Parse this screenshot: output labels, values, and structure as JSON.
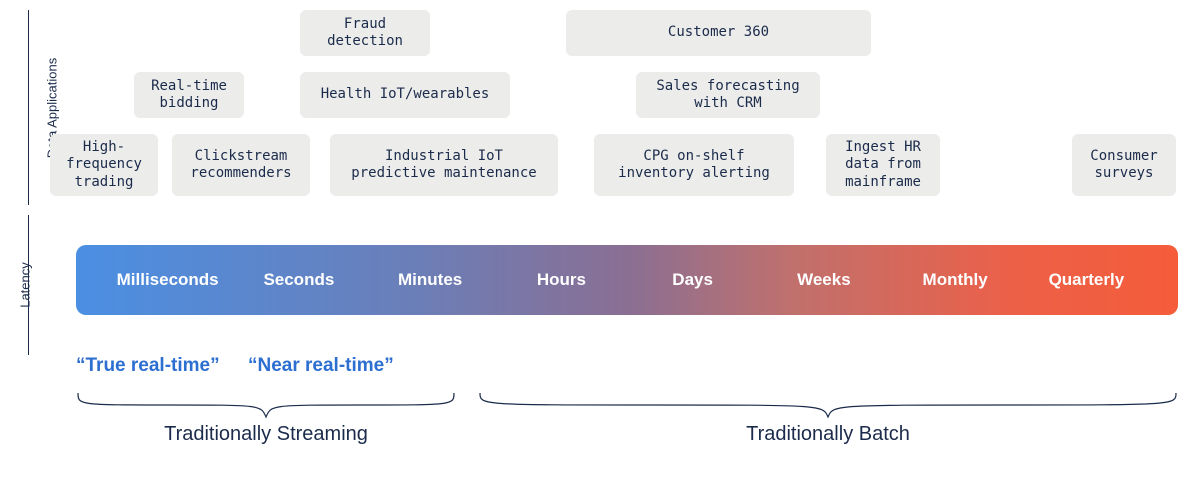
{
  "sections": {
    "apps_label": "Data Applications",
    "latency_label": "Latency"
  },
  "chips": {
    "fraud": "Fraud\ndetection",
    "customer360": "Customer 360",
    "rtb": "Real-time\nbidding",
    "healthiot": "Health IoT/wearables",
    "salesforecast": "Sales forecasting\nwith CRM",
    "hft": "High-\nfrequency\ntrading",
    "clickstream": "Clickstream\nrecommenders",
    "iiot": "Industrial IoT\npredictive maintenance",
    "cpg": "CPG on-shelf\ninventory alerting",
    "hr": "Ingest HR\ndata from\nmainframe",
    "surveys": "Consumer\nsurveys"
  },
  "latency_scale": {
    "ms": "Milliseconds",
    "sec": "Seconds",
    "min": "Minutes",
    "hr": "Hours",
    "day": "Days",
    "wk": "Weeks",
    "mo": "Monthly",
    "qtr": "Quarterly"
  },
  "realtime": {
    "true_rt": "“True real-time”",
    "near_rt": "“Near real-time”"
  },
  "braces": {
    "streaming": "Traditionally Streaming",
    "batch": "Traditionally Batch"
  },
  "colors": {
    "chip_bg": "#ececea",
    "accent_blue": "#2d6fd1",
    "gradient_start": "#4b8fe3",
    "gradient_end": "#f45c3a"
  }
}
